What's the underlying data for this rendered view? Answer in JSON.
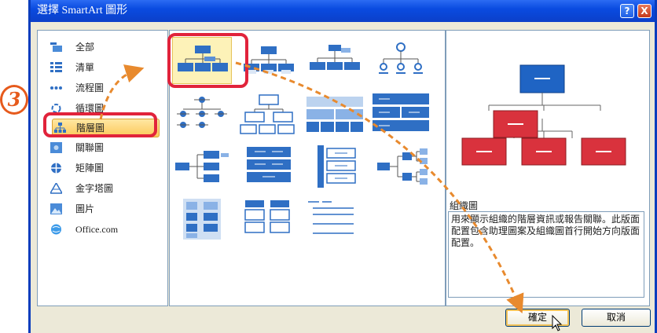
{
  "dialog": {
    "title": "選擇 SmartArt 圖形",
    "help_label": "?",
    "close_label": "X",
    "step_number": "3"
  },
  "categories": [
    {
      "label": "全部",
      "icon": "all-icon"
    },
    {
      "label": "清單",
      "icon": "list-icon"
    },
    {
      "label": "流程圖",
      "icon": "process-icon"
    },
    {
      "label": "循環圖",
      "icon": "cycle-icon"
    },
    {
      "label": "階層圖",
      "icon": "hierarchy-icon",
      "selected": true
    },
    {
      "label": "關聯圖",
      "icon": "relationship-icon"
    },
    {
      "label": "矩陣圖",
      "icon": "matrix-icon"
    },
    {
      "label": "金字塔圖",
      "icon": "pyramid-icon"
    },
    {
      "label": "圖片",
      "icon": "picture-icon"
    },
    {
      "label": "Office.com",
      "icon": "office-icon"
    }
  ],
  "preview": {
    "name": "組織圖",
    "description": "用來顯示組織的階層資訊或報告關聯。此版面配置包含助理圖案及組織圖首行開始方向版面配置。"
  },
  "buttons": {
    "ok": "確定",
    "cancel": "取消"
  },
  "colors": {
    "accent_blue": "#2f6fc4",
    "preview_red": "#d9323d",
    "highlight_red": "#e1233b",
    "arrow_orange": "#e88a2e"
  }
}
